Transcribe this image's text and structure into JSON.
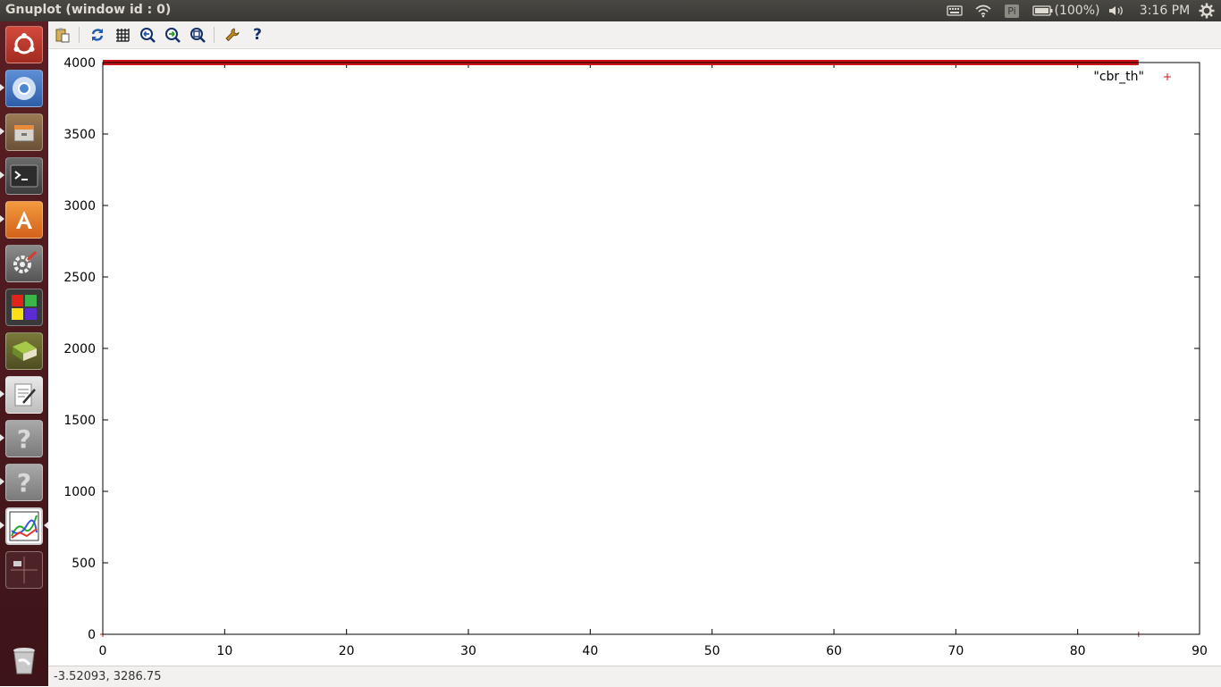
{
  "window": {
    "title": "Gnuplot (window id : 0)"
  },
  "tray": {
    "battery": "(100%)",
    "clock": "3:16 PM",
    "input_badge": "Pi"
  },
  "launcher": {
    "items": [
      {
        "name": "ubuntu-dash"
      },
      {
        "name": "chromium-browser"
      },
      {
        "name": "file-manager"
      },
      {
        "name": "terminal"
      },
      {
        "name": "software-center"
      },
      {
        "name": "system-settings"
      },
      {
        "name": "workspaces"
      },
      {
        "name": "book-app"
      },
      {
        "name": "text-editor"
      },
      {
        "name": "unknown-app-1"
      },
      {
        "name": "unknown-app-2"
      },
      {
        "name": "gnuplot"
      },
      {
        "name": "workspace-switcher"
      },
      {
        "name": "trash"
      }
    ]
  },
  "toolbar": {
    "buttons": [
      "copy-to-clipboard",
      "replot",
      "grid",
      "previous-zoom",
      "next-zoom",
      "autoscale",
      "preferences",
      "help"
    ]
  },
  "status": {
    "coordinates": "-3.52093,  3286.75"
  },
  "colors": {
    "series": "#cc1418",
    "launcher_bg": "#4d1a1f",
    "topbar_bg": "#3c3b37"
  },
  "chart_data": {
    "type": "scatter",
    "title": "",
    "xlabel": "",
    "ylabel": "",
    "xlim": [
      0,
      90
    ],
    "ylim": [
      0,
      4000
    ],
    "xticks": [
      0,
      10,
      20,
      30,
      40,
      50,
      60,
      70,
      80,
      90
    ],
    "yticks": [
      0,
      500,
      1000,
      1500,
      2000,
      2500,
      3000,
      3500,
      4000
    ],
    "grid": false,
    "legend_position": "top-right",
    "series": [
      {
        "name": "\"cbr_th\"",
        "marker": "+",
        "color": "#cc1418",
        "dense_band": {
          "x_from": 0,
          "x_to": 85,
          "y": 4000
        },
        "points": [
          {
            "x": 0,
            "y": 0
          },
          {
            "x": 85,
            "y": 0
          }
        ]
      }
    ]
  }
}
